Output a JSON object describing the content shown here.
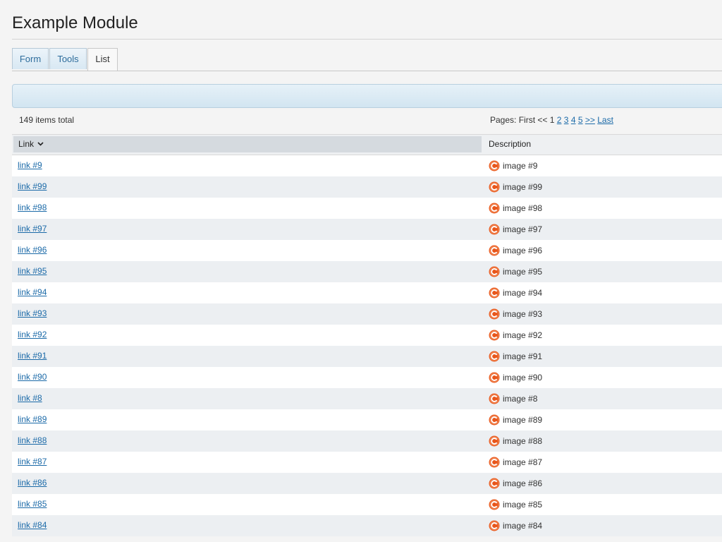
{
  "page": {
    "title": "Example Module"
  },
  "tabs": [
    {
      "label": "Form",
      "active": false
    },
    {
      "label": "Tools",
      "active": false
    },
    {
      "label": "List",
      "active": true
    }
  ],
  "list": {
    "summary": "149 items total",
    "pager": {
      "label": "Pages:",
      "first": "First",
      "prev": "<<",
      "current": "1",
      "pages": [
        "2",
        "3",
        "4",
        "5"
      ],
      "next": ">>",
      "last": "Last"
    },
    "columns": {
      "link": "Link",
      "description": "Description"
    },
    "icon": "orange-image-icon",
    "rows": [
      {
        "link": "link #9",
        "description": "image #9"
      },
      {
        "link": "link #99",
        "description": "image #99"
      },
      {
        "link": "link #98",
        "description": "image #98"
      },
      {
        "link": "link #97",
        "description": "image #97"
      },
      {
        "link": "link #96",
        "description": "image #96"
      },
      {
        "link": "link #95",
        "description": "image #95"
      },
      {
        "link": "link #94",
        "description": "image #94"
      },
      {
        "link": "link #93",
        "description": "image #93"
      },
      {
        "link": "link #92",
        "description": "image #92"
      },
      {
        "link": "link #91",
        "description": "image #91"
      },
      {
        "link": "link #90",
        "description": "image #90"
      },
      {
        "link": "link #8",
        "description": "image #8"
      },
      {
        "link": "link #89",
        "description": "image #89"
      },
      {
        "link": "link #88",
        "description": "image #88"
      },
      {
        "link": "link #87",
        "description": "image #87"
      },
      {
        "link": "link #86",
        "description": "image #86"
      },
      {
        "link": "link #85",
        "description": "image #85"
      },
      {
        "link": "link #84",
        "description": "image #84"
      }
    ]
  },
  "colors": {
    "link": "#1b6aa8",
    "icon": "#e8561b",
    "tab_text": "#2e6d9c",
    "row_alt": "#eceff2"
  }
}
